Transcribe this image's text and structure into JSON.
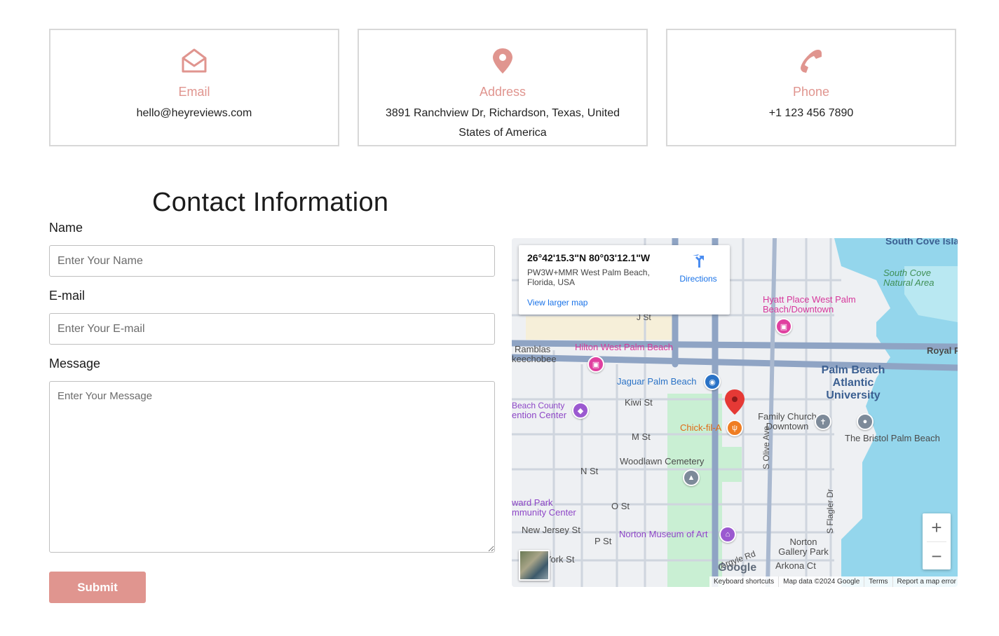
{
  "cards": [
    {
      "icon": "envelope-open-icon",
      "title": "Email",
      "value": "hello@heyreviews.com"
    },
    {
      "icon": "map-pin-icon",
      "title": "Address",
      "value": "3891 Ranchview Dr, Richardson, Texas, United States of America"
    },
    {
      "icon": "phone-icon",
      "title": "Phone",
      "value": "+1 123 456 7890"
    }
  ],
  "form": {
    "heading": "Contact Information",
    "name_label": "Name",
    "name_placeholder": "Enter Your Name",
    "email_label": "E-mail",
    "email_placeholder": "Enter Your E-mail",
    "message_label": "Message",
    "message_placeholder": "Enter Your Message",
    "submit_label": "Submit"
  },
  "map": {
    "info": {
      "coords": "26°42'15.3\"N 80°03'12.1\"W",
      "address": "PW3W+MMR West Palm Beach, Florida, USA",
      "directions_label": "Directions",
      "larger_map_label": "View larger map"
    },
    "labels": {
      "south_cove_islands": "South Cove Islands",
      "south_cove_natural": "South Cove Natural Area",
      "hyatt": "Hyatt Place West Palm Beach/Downtown",
      "hilton": "Hilton West Palm Beach",
      "ramblas": "Ramblas",
      "okeechobee": "keechobee",
      "royal": "Royal P",
      "pba_university": "Palm Beach Atlantic University",
      "jaguar": "Jaguar Palm Beach",
      "kiwi": "Kiwi St",
      "beach_county": "Beach County",
      "convention": "ention Center",
      "family_church": "Family Church Downtown",
      "bristol": "The Bristol Palm Beach",
      "chick": "Chick-fil-A",
      "m_st": "M St",
      "woodlawn": "Woodlawn Cemetery",
      "n_st": "N St",
      "olive": "S Olive Ave",
      "flagler": "S Flagler Dr",
      "ward_park": "ward Park",
      "community": "mmunity Center",
      "o_st": "O St",
      "new_jersey": "New Jersey St",
      "p_st": "P St",
      "norton": "Norton Museum of Art",
      "norton_gallery": "Norton Gallery Park",
      "argyle": "Argyle Rd",
      "arkona": "Arkona Ct",
      "york": "York St",
      "j_st": "J St"
    },
    "zoom_in": "+",
    "zoom_out": "−",
    "google": "Google",
    "attribution": [
      "Keyboard shortcuts",
      "Map data ©2024 Google",
      "Terms",
      "Report a map error"
    ]
  }
}
